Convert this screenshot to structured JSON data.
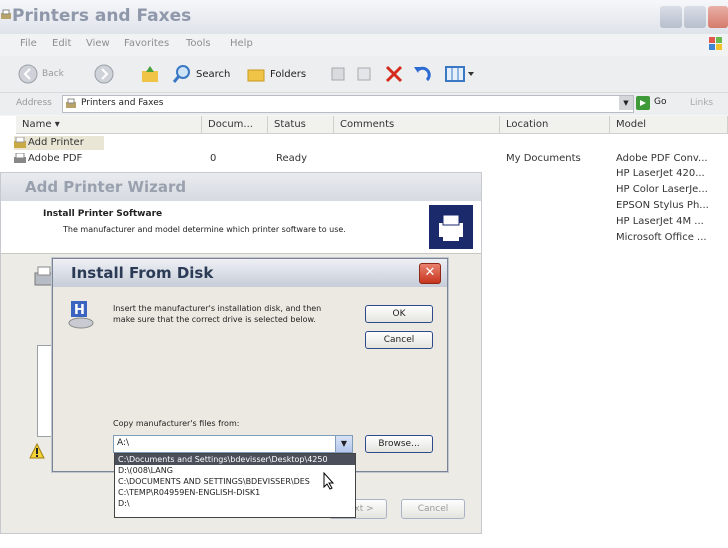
{
  "window": {
    "title": "Printers and Faxes",
    "menu": [
      "File",
      "Edit",
      "View",
      "Favorites",
      "Tools",
      "Help"
    ],
    "toolbar": {
      "back": "Back",
      "search": "Search",
      "folders": "Folders"
    },
    "address_label": "Address",
    "address_value": "Printers and Faxes",
    "go": "Go",
    "links": "Links"
  },
  "columns": [
    "Name",
    "Docum...",
    "Status",
    "Comments",
    "Location",
    "Model"
  ],
  "rows": [
    {
      "name": "Add Printer",
      "docs": "",
      "status": "",
      "location": "",
      "model": ""
    },
    {
      "name": "Adobe PDF",
      "docs": "0",
      "status": "Ready",
      "location": "My Documents",
      "model": "Adobe PDF Conv..."
    }
  ],
  "models_extra": [
    "HP LaserJet 420...",
    "HP Color LaserJe...",
    "EPSON Stylus Ph...",
    "HP LaserJet 4M ...",
    "Microsoft Office ..."
  ],
  "wizard": {
    "title": "Add Printer Wizard",
    "heading": "Install Printer Software",
    "subheading": "The manufacturer and model determine which printer software to use.",
    "next": "Next >",
    "cancel": "Cancel"
  },
  "install_dialog": {
    "title": "Install From Disk",
    "message": "Insert the manufacturer's installation disk, and then make sure that the correct drive is selected below.",
    "ok": "OK",
    "cancel": "Cancel",
    "copy_label": "Copy manufacturer's files from:",
    "combo_value": "A:\\",
    "browse": "Browse...",
    "options": [
      "C:\\Documents and Settings\\bdevisser\\Desktop\\4250",
      "D:\\(008\\LANG",
      "C:\\DOCUMENTS AND SETTINGS\\BDEVISSER\\DES",
      "C:\\TEMP\\R04959EN-ENGLISH-DISK1",
      "D:\\"
    ]
  },
  "colors": {
    "titlebar_text": "#8f98aa",
    "dialog_title": "#2b3a55",
    "close_red": "#c8351e",
    "selection": "#4a4f5a"
  }
}
